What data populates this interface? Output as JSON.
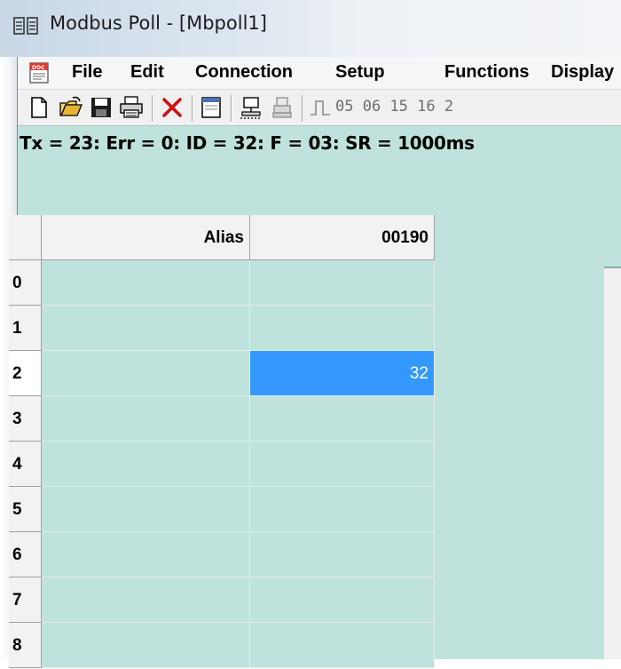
{
  "window": {
    "title": "Modbus Poll - [Mbpoll1]"
  },
  "menu": {
    "items": [
      "File",
      "Edit",
      "Connection",
      "Setup",
      "Functions",
      "Display"
    ]
  },
  "toolbar": {
    "function_codes": "05 06 15 16 2"
  },
  "status": {
    "text": "Tx = 23: Err = 0: ID = 32: F = 03: SR = 1000ms"
  },
  "grid": {
    "columns": [
      "Alias",
      "00190"
    ],
    "rows": [
      {
        "index": "0",
        "alias": "",
        "value": ""
      },
      {
        "index": "1",
        "alias": "",
        "value": ""
      },
      {
        "index": "2",
        "alias": "",
        "value": "32"
      },
      {
        "index": "3",
        "alias": "",
        "value": ""
      },
      {
        "index": "4",
        "alias": "",
        "value": ""
      },
      {
        "index": "5",
        "alias": "",
        "value": ""
      },
      {
        "index": "6",
        "alias": "",
        "value": ""
      },
      {
        "index": "7",
        "alias": "",
        "value": ""
      },
      {
        "index": "8",
        "alias": "",
        "value": ""
      }
    ],
    "selected_row": "2"
  },
  "colors": {
    "grid_background": "#bfe3dc",
    "selection": "#3399ff"
  }
}
